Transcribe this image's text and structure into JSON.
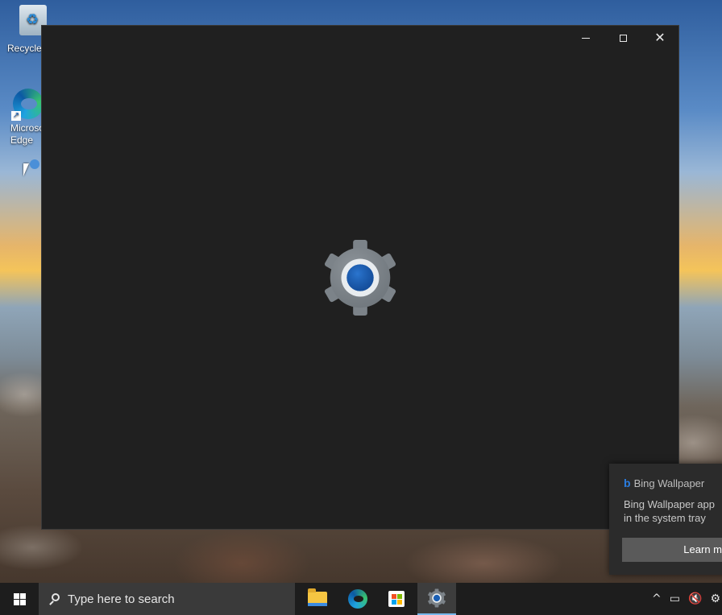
{
  "desktop": {
    "icons": [
      {
        "label": "Recycle",
        "name": "recycle-bin"
      },
      {
        "label": "Microso\nEdge",
        "name": "microsoft-edge"
      }
    ]
  },
  "window": {
    "minimize_icon": "minimize-icon",
    "maximize_icon": "maximize-icon",
    "close_icon": "close-icon",
    "close_glyph": "✕",
    "splash_icon": "settings-gear-icon"
  },
  "notification": {
    "app_name": "Bing Wallpaper",
    "body_line1": "Bing Wallpaper app",
    "body_line2": "in the system tray",
    "button_label": "Learn m"
  },
  "taskbar": {
    "search_placeholder": "Type here to search",
    "apps": [
      "file-explorer",
      "microsoft-edge",
      "microsoft-store",
      "settings"
    ],
    "tray": {
      "chevron": "^",
      "network_icon": "network-icon",
      "volume_icon": "volume-muted-icon",
      "settings_icon": "gear-icon"
    }
  },
  "colors": {
    "window_bg": "#202020",
    "taskbar_bg": "#1d1d1d",
    "accent": "#1a5fb4",
    "active_underline": "#76b9ed"
  }
}
